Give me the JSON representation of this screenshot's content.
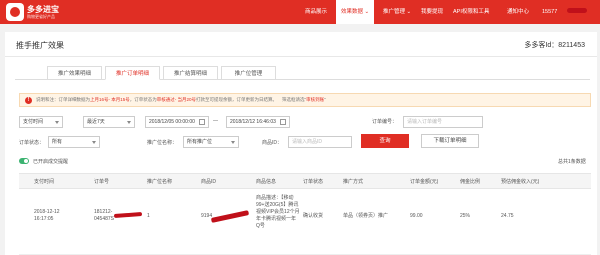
{
  "header": {
    "brand": "多多进宝",
    "brand_sub": "购物更省好产品",
    "nav": [
      "商品展示",
      "效果数据 ⌄",
      "推广管理 ⌄",
      "我要提现",
      "API权限和工具",
      "通知中心"
    ],
    "user": "15577"
  },
  "page": {
    "title": "推手推广效果",
    "account": "多多客Id：8211453"
  },
  "tabs": [
    "推广效果明细",
    "推广订单明细",
    "推广结算明细",
    "推广位管理"
  ],
  "notice": {
    "part1": "说明和注：订单详细数据为",
    "hl1": "上月16号- 本月15号",
    "part2": "，订单状态为",
    "hl2": "审核通过- 当月20号",
    "part3": "打款至可提现余额，订单更新为日结算。",
    "part4": "筛选框请选\"",
    "hl3": "审核到账",
    "part5": "\""
  },
  "filters": {
    "time_type": "支付时间",
    "range": "最近7天",
    "start": "2018/12/05 00:00:00",
    "sep": "—",
    "end": "2018/12/12 16:46:03",
    "order_id_label": "订单编号：",
    "order_id_placeholder": "请输入订单编号",
    "status_label": "订单状态：",
    "status_value": "所有",
    "pid_label": "推广位名称：",
    "pid_value": "所有推广位",
    "goods_id_label": "商品ID：",
    "goods_id_placeholder": "请输入商品ID",
    "query": "查询",
    "download": "下载订单明细"
  },
  "toggle_label": "已开启成交提醒",
  "total": "总共1条数据",
  "table": {
    "columns": [
      "支付时间",
      "订单号",
      "推广位名称",
      "商品ID",
      "商品信息",
      "订单状态",
      "推广方式",
      "订单金额(元)",
      "佣金比例",
      "预估佣金收入(元)"
    ],
    "row": {
      "time_date": "2018-12-12",
      "time_clock": "16:17:05",
      "order_1": "181212-",
      "order_2": "045487S",
      "pid": "1",
      "goods_id": "9194",
      "goods_info": [
        "商品描述：【移动",
        "99+送20G(5】腾讯",
        "视频VIP会员12个月",
        "年卡腾讯视频一年",
        "Q号"
      ],
      "status": "确认收货",
      "method": "单品（领券页）推广",
      "amount": "99.00",
      "rate": "25%",
      "income": "24.75"
    }
  }
}
